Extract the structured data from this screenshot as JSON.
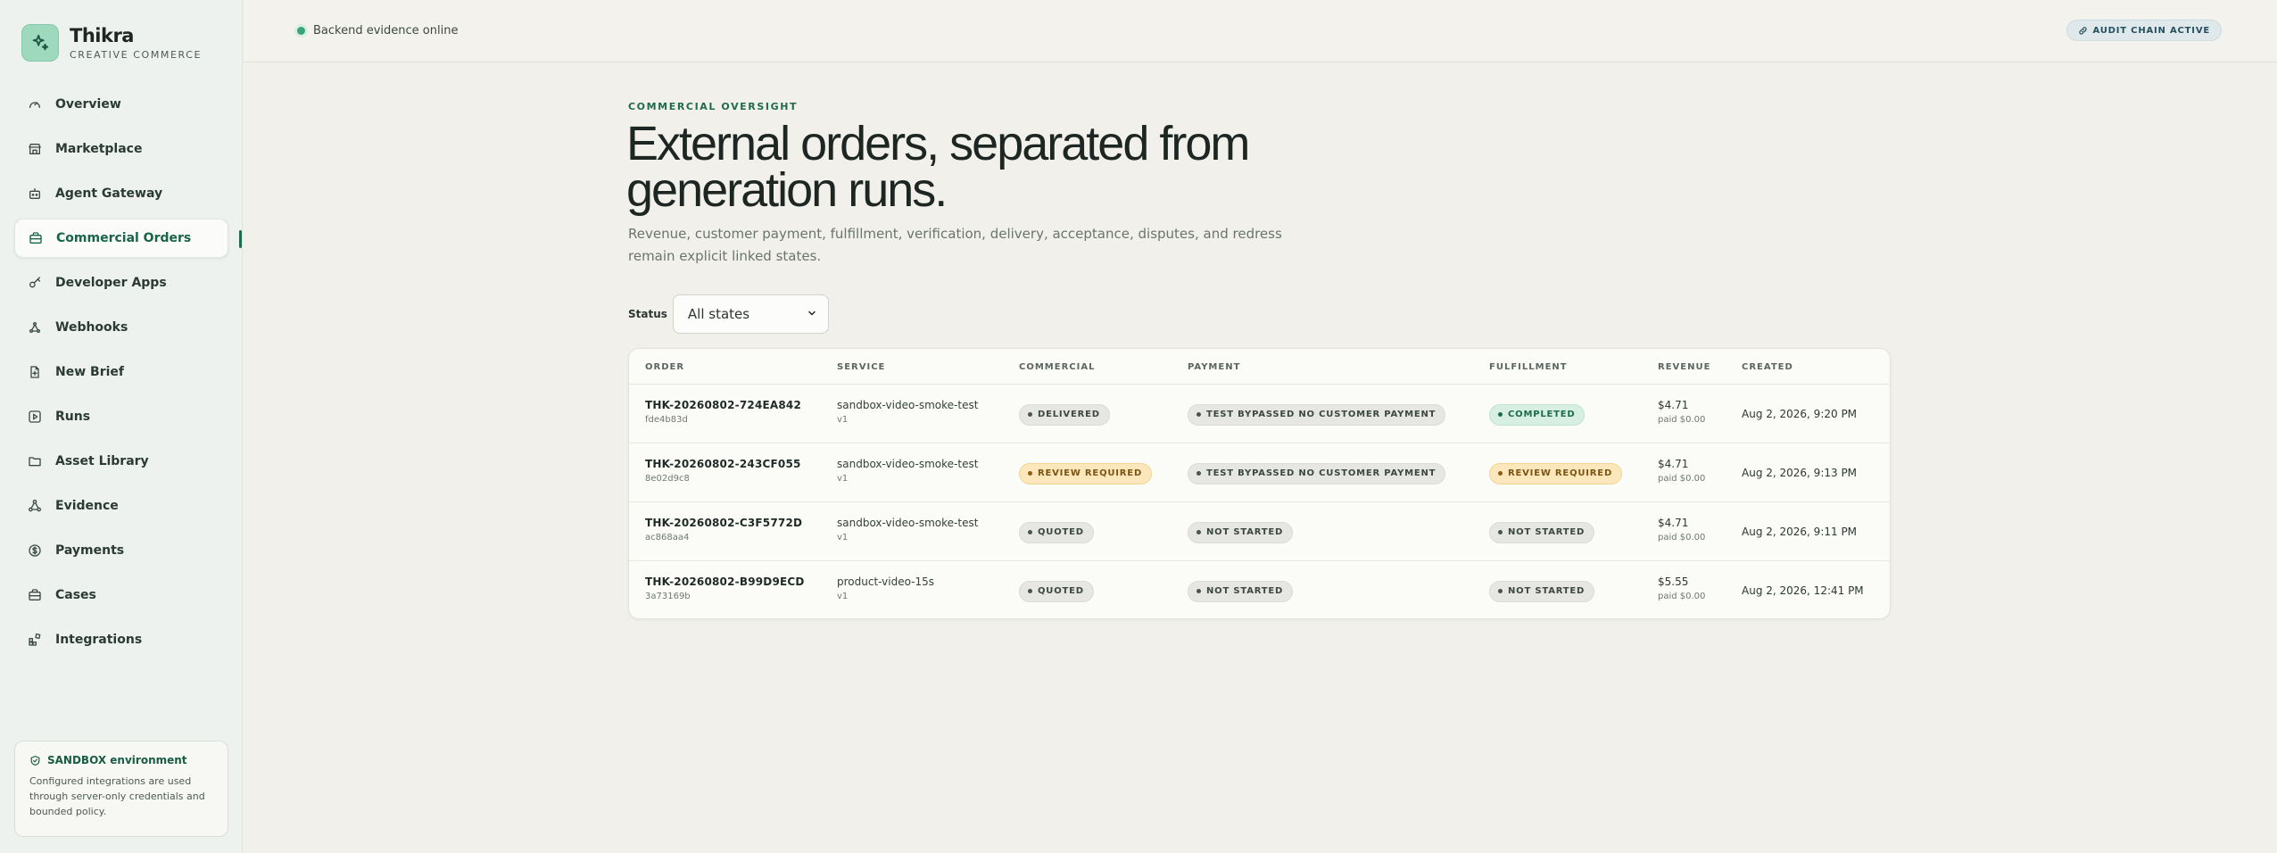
{
  "brand": {
    "name": "Thikra",
    "subtitle": "CREATIVE COMMERCE"
  },
  "nav": [
    {
      "label": "Overview",
      "icon": "gauge-icon"
    },
    {
      "label": "Marketplace",
      "icon": "store-icon"
    },
    {
      "label": "Agent Gateway",
      "icon": "bot-icon"
    },
    {
      "label": "Commercial Orders",
      "icon": "briefcase-icon",
      "active": true
    },
    {
      "label": "Developer Apps",
      "icon": "key-icon"
    },
    {
      "label": "Webhooks",
      "icon": "webhook-icon"
    },
    {
      "label": "New Brief",
      "icon": "file-plus-icon"
    },
    {
      "label": "Runs",
      "icon": "play-square-icon"
    },
    {
      "label": "Asset Library",
      "icon": "folder-icon"
    },
    {
      "label": "Evidence",
      "icon": "network-icon"
    },
    {
      "label": "Payments",
      "icon": "dollar-circle-icon"
    },
    {
      "label": "Cases",
      "icon": "briefcase-icon"
    },
    {
      "label": "Integrations",
      "icon": "blocks-icon"
    }
  ],
  "sandbox": {
    "title": "SANDBOX environment",
    "text": "Configured integrations are used through server-only credentials and bounded policy."
  },
  "topbar": {
    "status": "Backend evidence online",
    "audit": "AUDIT CHAIN ACTIVE"
  },
  "page": {
    "eyebrow": "COMMERCIAL OVERSIGHT",
    "headline": "External orders, separated from generation runs.",
    "lede": "Revenue, customer payment, fulfillment, verification, delivery, acceptance, disputes, and redress remain explicit linked states."
  },
  "filter": {
    "label": "Status",
    "value": "All states"
  },
  "table": {
    "headers": [
      "ORDER",
      "SERVICE",
      "COMMERCIAL",
      "PAYMENT",
      "FULFILLMENT",
      "REVENUE",
      "CREATED"
    ],
    "rows": [
      {
        "order": "THK-20260802-724EA842",
        "hash": "fde4b83d",
        "service": "sandbox-video-smoke-test",
        "version": "v1",
        "commercial": "DELIVERED",
        "commercial_tone": "neutral",
        "payment": "TEST BYPASSED NO CUSTOMER PAYMENT",
        "payment_tone": "neutral",
        "fulfillment": "COMPLETED",
        "fulfillment_tone": "green",
        "revenue": "$4.71",
        "paid": "paid $0.00",
        "created": "Aug 2, 2026, 9:20 PM"
      },
      {
        "order": "THK-20260802-243CF055",
        "hash": "8e02d9c8",
        "service": "sandbox-video-smoke-test",
        "version": "v1",
        "commercial": "REVIEW REQUIRED",
        "commercial_tone": "amber",
        "payment": "TEST BYPASSED NO CUSTOMER PAYMENT",
        "payment_tone": "neutral",
        "fulfillment": "REVIEW REQUIRED",
        "fulfillment_tone": "amber",
        "revenue": "$4.71",
        "paid": "paid $0.00",
        "created": "Aug 2, 2026, 9:13 PM"
      },
      {
        "order": "THK-20260802-C3F5772D",
        "hash": "ac868aa4",
        "service": "sandbox-video-smoke-test",
        "version": "v1",
        "commercial": "QUOTED",
        "commercial_tone": "neutral",
        "payment": "NOT STARTED",
        "payment_tone": "neutral",
        "fulfillment": "NOT STARTED",
        "fulfillment_tone": "neutral",
        "revenue": "$4.71",
        "paid": "paid $0.00",
        "created": "Aug 2, 2026, 9:11 PM"
      },
      {
        "order": "THK-20260802-B99D9ECD",
        "hash": "3a73169b",
        "service": "product-video-15s",
        "version": "v1",
        "commercial": "QUOTED",
        "commercial_tone": "neutral",
        "payment": "NOT STARTED",
        "payment_tone": "neutral",
        "fulfillment": "NOT STARTED",
        "fulfillment_tone": "neutral",
        "revenue": "$5.55",
        "paid": "paid $0.00",
        "created": "Aug 2, 2026, 12:41 PM"
      }
    ]
  }
}
